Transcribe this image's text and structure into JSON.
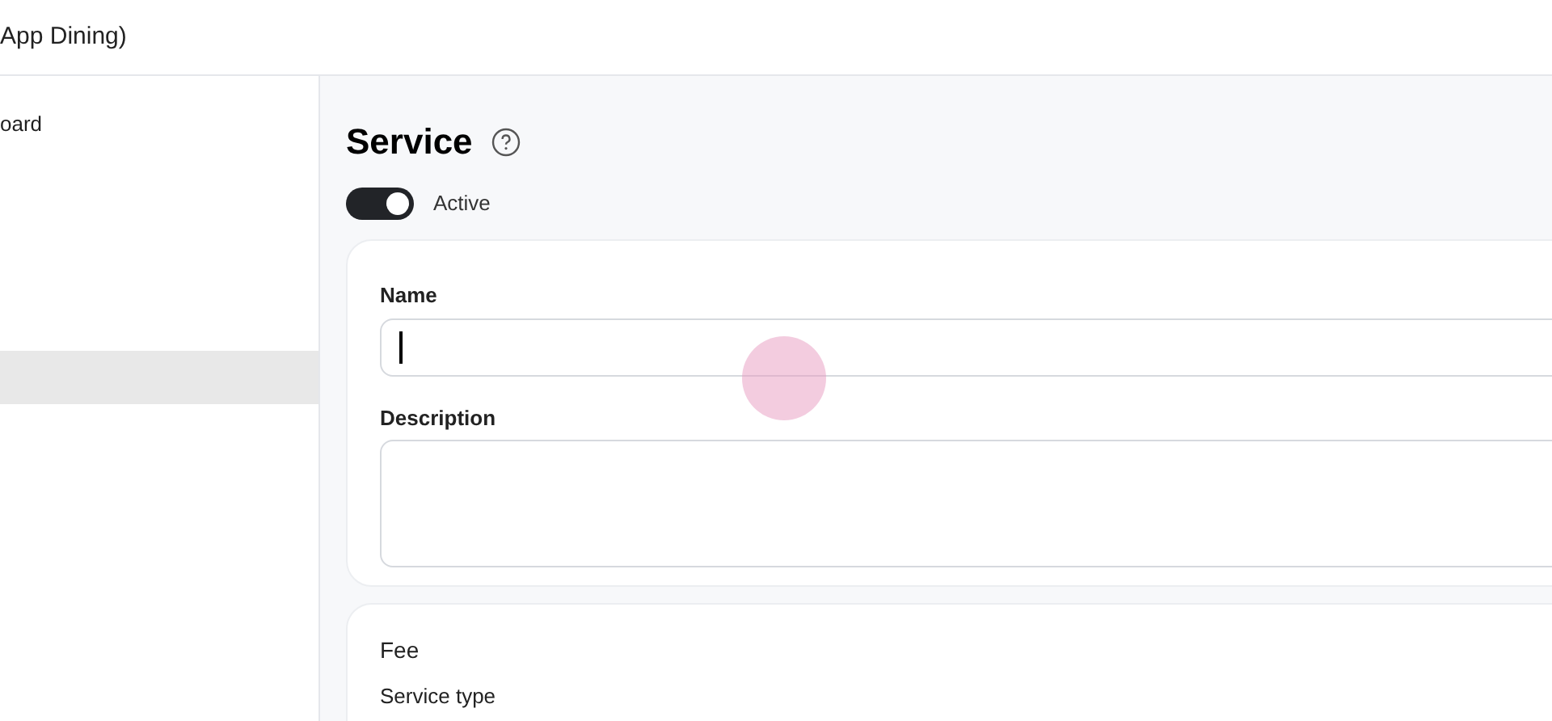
{
  "header": {
    "title": "App Dining)"
  },
  "sidebar": {
    "items": [
      {
        "label": "oard",
        "selected": false
      },
      {
        "selected": true
      }
    ]
  },
  "page": {
    "title": "Service",
    "active_toggle": {
      "label": "Active",
      "on": true
    }
  },
  "details_card": {
    "fields": [
      {
        "kind": "input",
        "label": "Name",
        "focused": true
      },
      {
        "kind": "textarea",
        "label": "Description",
        "focused": false
      }
    ]
  },
  "fee_card": {
    "title": "Fee",
    "fields": [
      {
        "label": "Service type"
      }
    ]
  },
  "pointer_highlight": {
    "shown": true
  }
}
